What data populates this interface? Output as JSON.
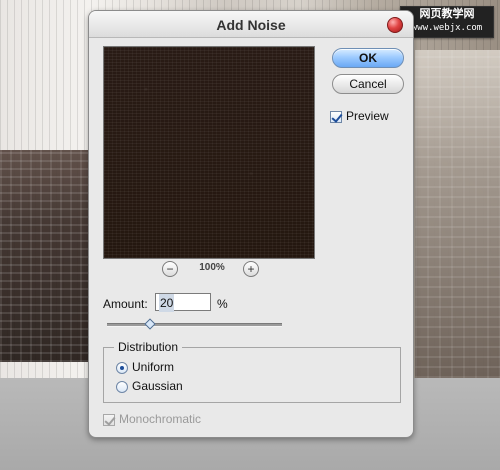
{
  "watermark": {
    "line1": "网页教学网",
    "line2": "www.webjx.com"
  },
  "dialog": {
    "title": "Add Noise",
    "buttons": {
      "ok": "OK",
      "cancel": "Cancel"
    },
    "preview": {
      "label": "Preview",
      "checked": true
    },
    "zoom": {
      "minus": "−",
      "level": "100%",
      "plus": "+"
    },
    "amount": {
      "label": "Amount:",
      "value": "20",
      "unit": "%",
      "slider_value_percent": 20
    },
    "distribution": {
      "title": "Distribution",
      "options": [
        {
          "label": "Uniform",
          "selected": true
        },
        {
          "label": "Gaussian",
          "selected": false
        }
      ]
    },
    "monochromatic": {
      "label": "Monochromatic",
      "checked": true,
      "disabled": true
    }
  }
}
